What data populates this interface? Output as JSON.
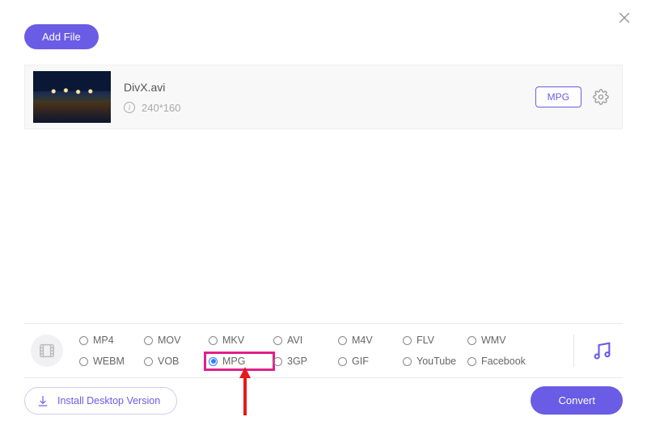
{
  "toolbar": {
    "add_file_label": "Add File"
  },
  "file": {
    "name": "DivX.avi",
    "resolution": "240*160",
    "selected_format": "MPG"
  },
  "formats": {
    "row1": [
      "MP4",
      "MOV",
      "MKV",
      "AVI",
      "M4V",
      "FLV",
      "WMV"
    ],
    "row2": [
      "WEBM",
      "VOB",
      "MPG",
      "3GP",
      "GIF",
      "YouTube",
      "Facebook"
    ],
    "selected": "MPG",
    "highlighted": "MPG"
  },
  "footer": {
    "install_label": "Install Desktop Version",
    "convert_label": "Convert"
  }
}
